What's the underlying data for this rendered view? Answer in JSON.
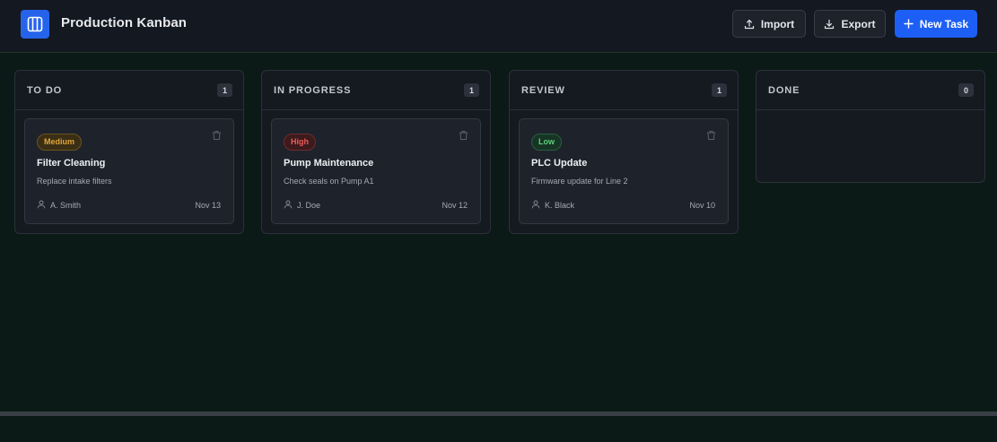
{
  "app": {
    "title": "Production Kanban",
    "logo_icon": "kanban-columns-icon"
  },
  "toolbar": {
    "import_label": "Import",
    "export_label": "Export",
    "new_task_label": "New Task",
    "import_icon": "upload-icon",
    "export_icon": "download-icon",
    "new_task_icon": "plus-icon"
  },
  "colors": {
    "accent": "#1d5ff5",
    "background": "#0b1a16",
    "panel": "#151920",
    "priority_medium": "#e0a43a",
    "priority_high": "#ef5a5a",
    "priority_low": "#5fcf7e"
  },
  "columns": [
    {
      "title": "TO DO",
      "count": "1",
      "cards": [
        {
          "priority": "Medium",
          "title": "Filter Cleaning",
          "description": "Replace intake filters",
          "assignee": "A. Smith",
          "date": "Nov 13"
        }
      ]
    },
    {
      "title": "IN PROGRESS",
      "count": "1",
      "cards": [
        {
          "priority": "High",
          "title": "Pump Maintenance",
          "description": "Check seals on Pump A1",
          "assignee": "J. Doe",
          "date": "Nov 12"
        }
      ]
    },
    {
      "title": "REVIEW",
      "count": "1",
      "cards": [
        {
          "priority": "Low",
          "title": "PLC Update",
          "description": "Firmware update for Line 2",
          "assignee": "K. Black",
          "date": "Nov 10"
        }
      ]
    },
    {
      "title": "DONE",
      "count": "0",
      "cards": []
    }
  ]
}
